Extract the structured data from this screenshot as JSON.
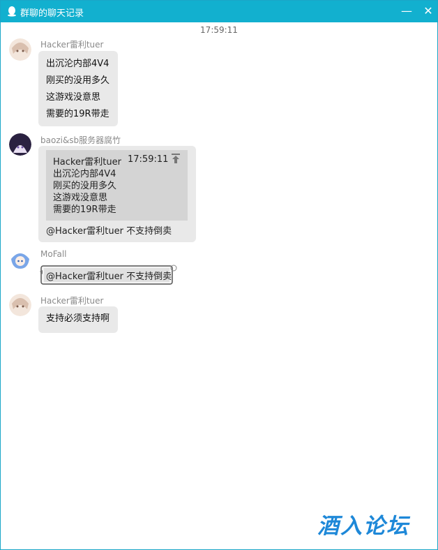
{
  "window": {
    "title": "群聊的聊天记录",
    "minimize_glyph": "—",
    "close_glyph": "✕",
    "accent_color": "#12b0cf"
  },
  "timestamp": "17:59:11",
  "messages": [
    {
      "sender": "Hacker雷利tuer",
      "lines": [
        "出沉沦内部4V4",
        "刚买的没用多久",
        "这游戏没意思",
        "需要的19R带走"
      ]
    },
    {
      "sender": "baozi&sb服务器腐竹",
      "quote": {
        "sender": "Hacker雷利tuer",
        "time": "17:59:11",
        "lines": [
          "出沉沦内部4V4",
          "刚买的没用多久",
          "这游戏没意思",
          "需要的19R带走"
        ]
      },
      "text": "@Hacker雷利tuer 不支持倒卖"
    },
    {
      "sender": "MoFall",
      "text": "@Hacker雷利tuer 不支持倒卖"
    },
    {
      "sender": "Hacker雷利tuer",
      "text": "支持必须支持啊"
    }
  ],
  "watermark": "酒入论坛"
}
